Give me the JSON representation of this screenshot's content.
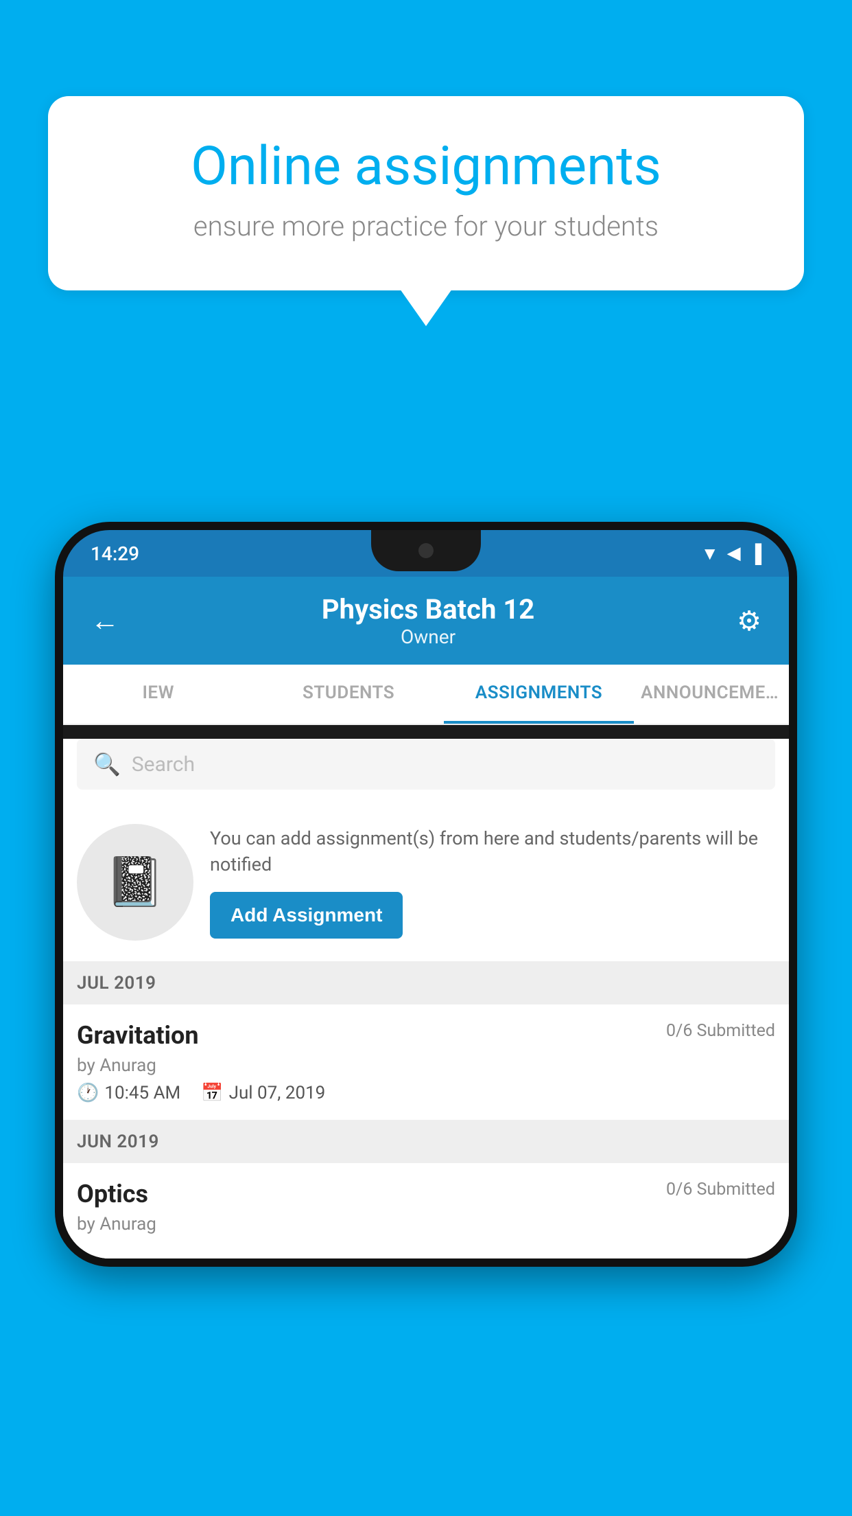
{
  "background": {
    "color": "#00AEEF"
  },
  "speech_bubble": {
    "title": "Online assignments",
    "subtitle": "ensure more practice for your students"
  },
  "status_bar": {
    "time": "14:29",
    "signal_icons": "▼◀▐"
  },
  "app_header": {
    "title": "Physics Batch 12",
    "subtitle": "Owner",
    "back_icon": "←",
    "settings_icon": "⚙"
  },
  "tabs": [
    {
      "label": "IEW",
      "active": false
    },
    {
      "label": "STUDENTS",
      "active": false
    },
    {
      "label": "ASSIGNMENTS",
      "active": true
    },
    {
      "label": "ANNOUNCEMENTS",
      "active": false
    }
  ],
  "search": {
    "placeholder": "Search"
  },
  "empty_state": {
    "description": "You can add assignment(s) from here and students/parents will be notified",
    "button_label": "Add Assignment"
  },
  "sections": [
    {
      "label": "JUL 2019",
      "assignments": [
        {
          "title": "Gravitation",
          "submitted": "0/6 Submitted",
          "author": "by Anurag",
          "time": "10:45 AM",
          "date": "Jul 07, 2019"
        }
      ]
    },
    {
      "label": "JUN 2019",
      "assignments": [
        {
          "title": "Optics",
          "submitted": "0/6 Submitted",
          "author": "by Anurag",
          "time": "",
          "date": ""
        }
      ]
    }
  ]
}
